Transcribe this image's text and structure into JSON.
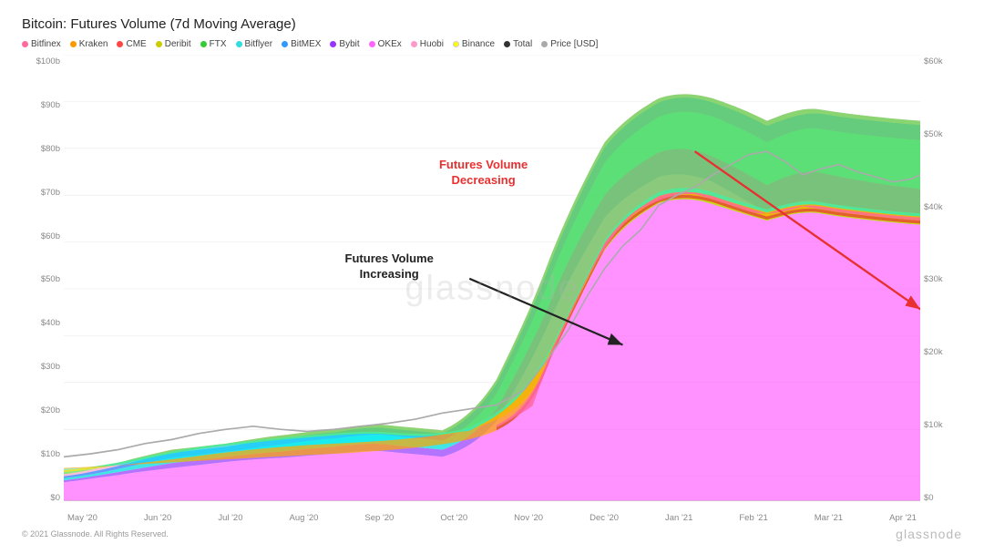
{
  "title": "Bitcoin: Futures Volume (7d Moving Average)",
  "legend": {
    "items": [
      {
        "label": "Bitfinex",
        "color": "#ff6b9d"
      },
      {
        "label": "Kraken",
        "color": "#ff9900"
      },
      {
        "label": "CME",
        "color": "#ff4444"
      },
      {
        "label": "Deribit",
        "color": "#cccc00"
      },
      {
        "label": "FTX",
        "color": "#33cc33"
      },
      {
        "label": "Bitflyer",
        "color": "#33dddd"
      },
      {
        "label": "BitMEX",
        "color": "#3399ff"
      },
      {
        "label": "Bybit",
        "color": "#9933ff"
      },
      {
        "label": "OKEx",
        "color": "#ff66ff"
      },
      {
        "label": "Huobi",
        "color": "#ff99cc"
      },
      {
        "label": "Binance",
        "color": "#ffff00"
      },
      {
        "label": "Total",
        "color": "#333333"
      },
      {
        "label": "Price [USD]",
        "color": "#aaaaaa"
      }
    ]
  },
  "yAxis": {
    "left": [
      "$100b",
      "$90b",
      "$80b",
      "$70b",
      "$60b",
      "$50b",
      "$40b",
      "$30b",
      "$20b",
      "$10b",
      "$0"
    ],
    "right": [
      "$60k",
      "$50k",
      "$40k",
      "$30k",
      "$20k",
      "$10k",
      "$0"
    ]
  },
  "xAxis": [
    "May '20",
    "Jun '20",
    "Jul '20",
    "Aug '20",
    "Sep '20",
    "Oct '20",
    "Nov '20",
    "Dec '20",
    "Jan '21",
    "Feb '21",
    "Mar '21",
    "Apr '21"
  ],
  "annotations": {
    "decreasing_label": "Futures Volume\nDecreasing",
    "increasing_label": "Futures Volume\nIncreasing"
  },
  "watermark": "glassnode",
  "footer": {
    "copyright": "© 2021 Glassnode. All Rights Reserved.",
    "brand": "glassnode"
  }
}
